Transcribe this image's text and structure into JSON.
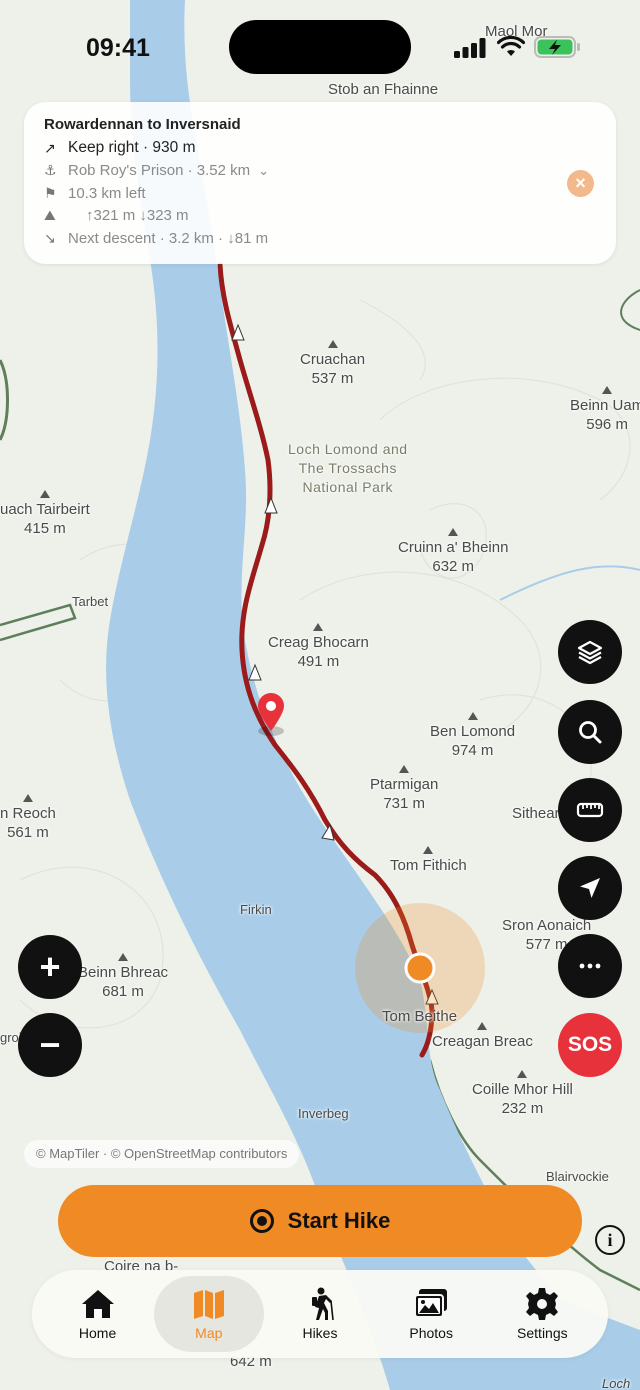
{
  "status_bar": {
    "time": "09:41",
    "battery_icon": "battery-charging-icon",
    "wifi_icon": "wifi-icon",
    "signal_icon": "cell-signal-icon"
  },
  "route_card": {
    "title": "Rowardennan to Inversnaid",
    "direction": "Keep right · 930 m",
    "waypoint": "Rob Roy's Prison · 3.52 km",
    "remaining": "10.3 km left",
    "elevation": "↑321 m ↓323 m",
    "next_descent": "Next descent · 3.2 km · ↓81 m"
  },
  "map_labels": {
    "maol_mor": "Maol Mor",
    "maol_mor_elev": "685 m",
    "stob_an_fhainne": "Stob an Fhainne",
    "cruachan": "Cruachan",
    "cruachan_elev": "537 m",
    "beinn_uamha": "Beinn Uam",
    "beinn_uamha_elev": "596 m",
    "park": "Loch Lomond and\nThe Trossachs\nNational Park",
    "tairbeirt": "uach Tairbeirt",
    "tairbeirt_elev": "415 m",
    "cruinn": "Cruinn a' Bheinn",
    "cruinn_elev": "632 m",
    "tarbet": "Tarbet",
    "creag_bhocarn": "Creag Bhocarn",
    "creag_bhocarn_elev": "491 m",
    "ben_lomond": "Ben Lomond",
    "ben_lomond_elev": "974 m",
    "ptarmigan": "Ptarmigan",
    "ptarmigan_elev": "731 m",
    "sithean": "Sithear",
    "reoch": "n Reoch",
    "reoch_elev": "561 m",
    "tom_fithich": "Tom Fithich",
    "firkin": "Firkin",
    "sron": "Sron Aonaich",
    "sron_elev": "577 m",
    "beinn_bhreac": "Beinn Bhreac",
    "beinn_bhreac_elev": "681 m",
    "tom_beithe": "Tom Beithe",
    "creagan_breac": "Creagan Breac",
    "groi": "groi",
    "coille_mhor": "Coille Mhor Hill",
    "coille_mhor_elev": "232 m",
    "inverbeg": "Inverbeg",
    "blairvockie": "Blairvockie",
    "coire": "Coire na b-",
    "bottom_elev": "642 m",
    "loch": "Loch"
  },
  "attribution": "© MapTiler · © OpenStreetMap contributors",
  "start_button": "Start Hike",
  "tabs": [
    {
      "label": "Home",
      "icon": "home-icon"
    },
    {
      "label": "Map",
      "icon": "map-icon"
    },
    {
      "label": "Hikes",
      "icon": "hiker-icon"
    },
    {
      "label": "Photos",
      "icon": "photos-icon"
    },
    {
      "label": "Settings",
      "icon": "gear-icon"
    }
  ],
  "sos_label": "SOS",
  "colors": {
    "accent": "#f08a24",
    "route": "#9b1b1b",
    "water": "#a9cde9",
    "land": "#eef1ea",
    "sos": "#e8323b"
  }
}
